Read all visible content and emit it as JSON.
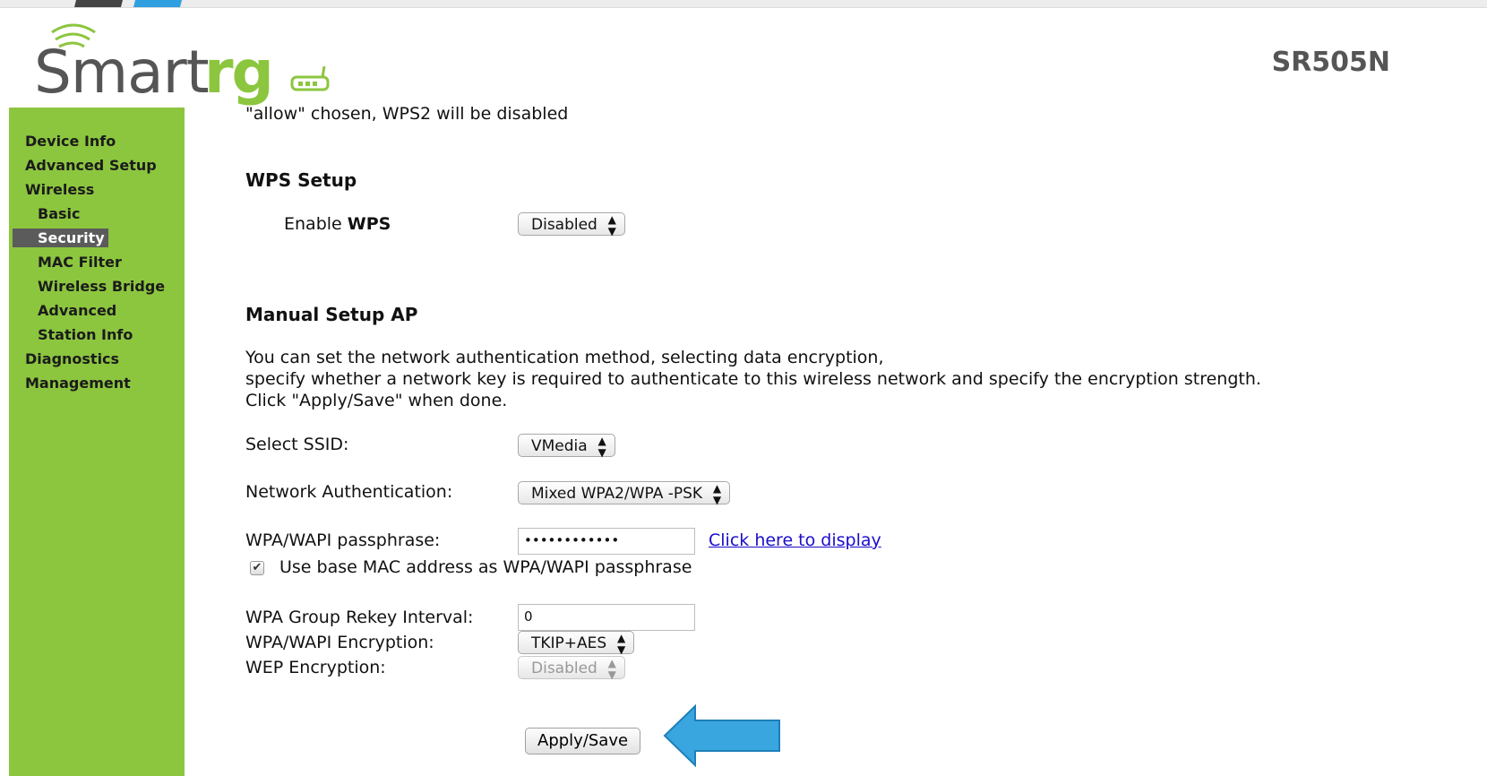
{
  "logo": {
    "smart": "Smart",
    "rg": "rg"
  },
  "model": "SR505N",
  "sidebar": {
    "items": [
      {
        "label": "Device Info"
      },
      {
        "label": "Advanced Setup"
      },
      {
        "label": "Wireless"
      },
      {
        "label": "Basic"
      },
      {
        "label": "Security"
      },
      {
        "label": "MAC Filter"
      },
      {
        "label": "Wireless Bridge"
      },
      {
        "label": "Advanced"
      },
      {
        "label": "Station Info"
      },
      {
        "label": "Diagnostics"
      },
      {
        "label": "Management"
      }
    ]
  },
  "content": {
    "wps_note": "\"allow\" chosen, WPS2 will be disabled",
    "wps_setup_heading": "WPS Setup",
    "enable_wps_prefix": "Enable ",
    "enable_wps_bold": "WPS",
    "enable_wps_value": "Disabled",
    "manual_heading": "Manual Setup AP",
    "desc_line1": "You can set the network authentication method, selecting data encryption,",
    "desc_line2": "specify whether a network key is required to authenticate to this wireless network and specify the encryption strength.",
    "desc_line3": "Click \"Apply/Save\" when done.",
    "ssid_label": "Select SSID:",
    "ssid_value": "VMedia",
    "auth_label": "Network Authentication:",
    "auth_value": "Mixed WPA2/WPA -PSK",
    "pass_label": "WPA/WAPI passphrase:",
    "pass_value": "••••••••••••",
    "display_link": "Click here to display",
    "mac_check_label": "Use base MAC address as WPA/WAPI passphrase",
    "mac_checked": true,
    "rekey_label": "WPA Group Rekey Interval:",
    "rekey_value": "0",
    "enc_label": "WPA/WAPI Encryption:",
    "enc_value": "TKIP+AES",
    "wep_label": "WEP Encryption:",
    "wep_value": "Disabled",
    "apply_button": "Apply/Save"
  },
  "colors": {
    "sidebar_green": "#8cc63f",
    "active_nav": "#5b5b5b",
    "arrow_blue": "#3aa6e0",
    "link_blue": "#1a0dcc"
  }
}
